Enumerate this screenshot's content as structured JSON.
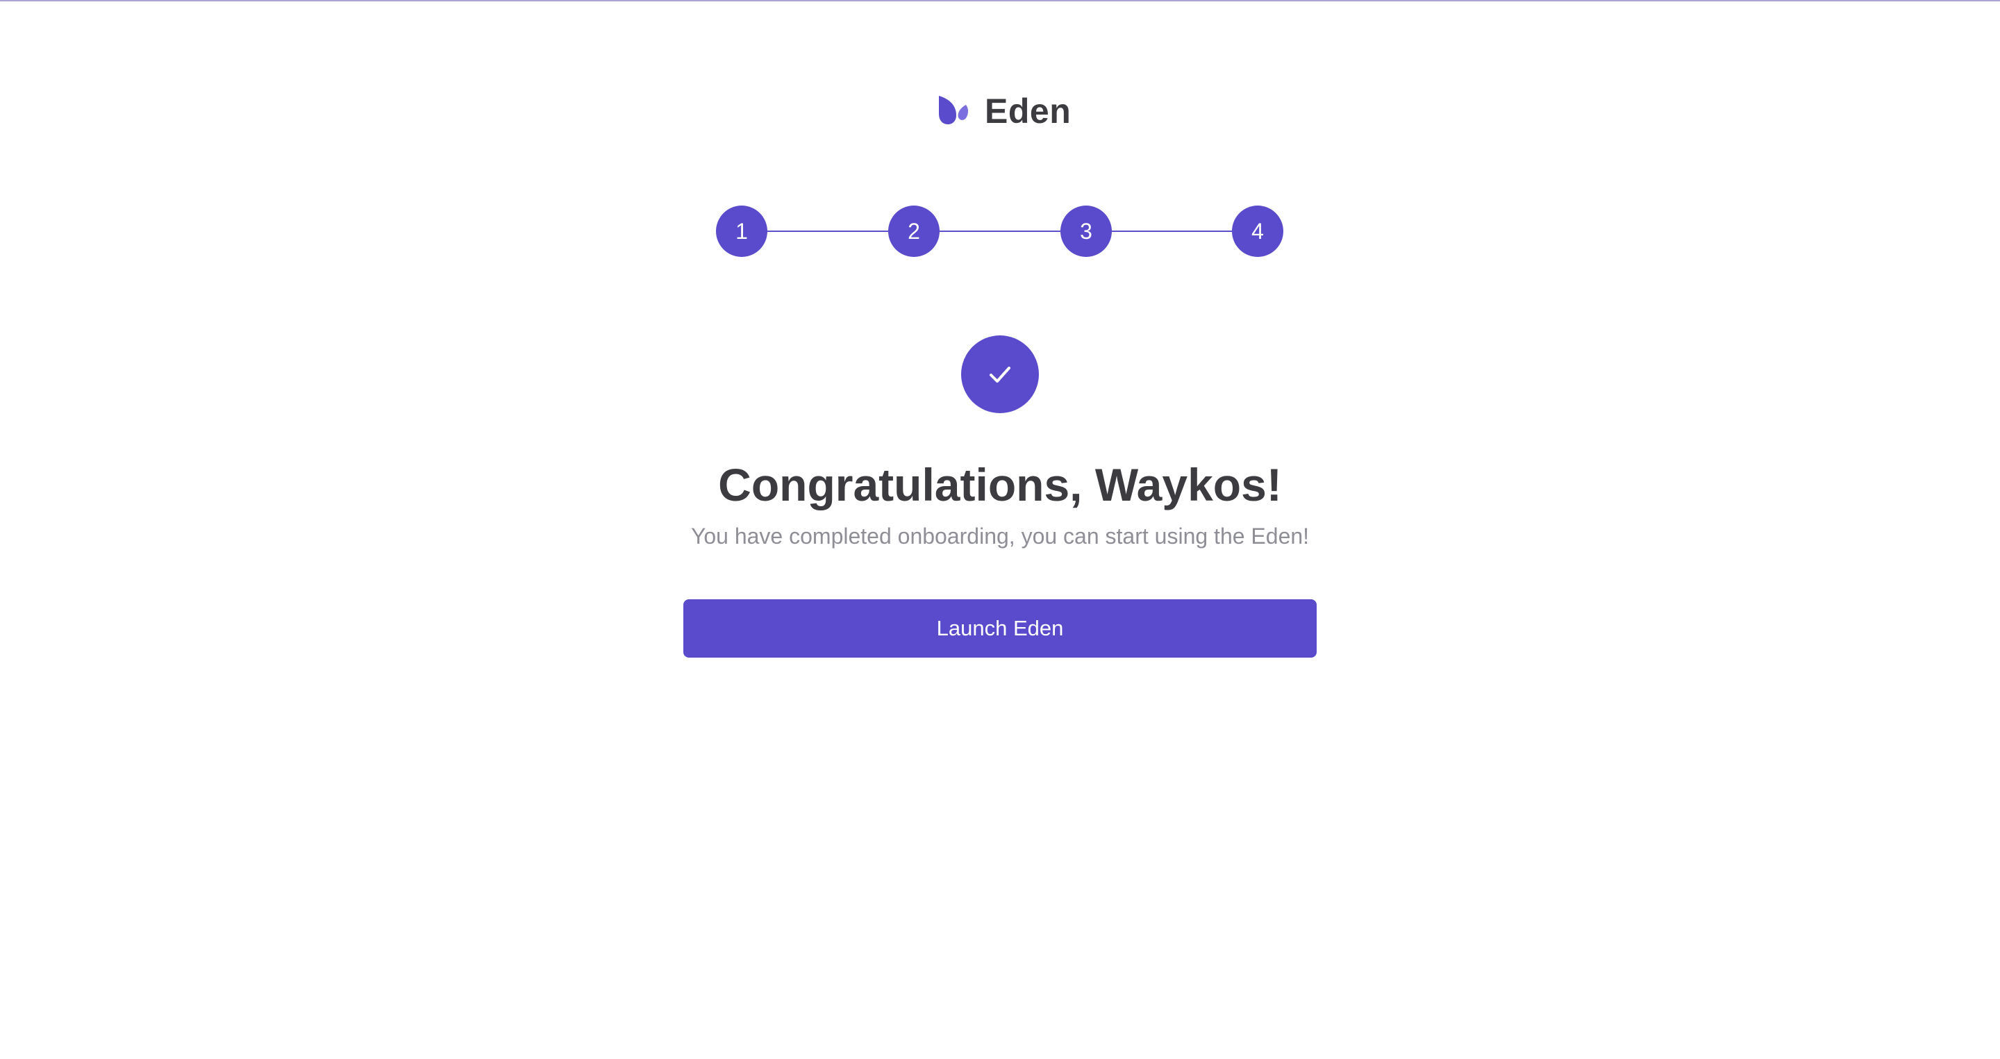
{
  "brand": {
    "name": "Eden",
    "logo_icon": "leaf-logo-icon",
    "accent_color": "#594bcb"
  },
  "stepper": {
    "steps": [
      {
        "label": "1",
        "status": "complete"
      },
      {
        "label": "2",
        "status": "complete"
      },
      {
        "label": "3",
        "status": "complete"
      },
      {
        "label": "4",
        "status": "complete"
      }
    ]
  },
  "completion": {
    "icon": "checkmark-icon",
    "title": "Congratulations, Waykos!",
    "subtitle": "You have completed onboarding, you can start using the Eden!"
  },
  "actions": {
    "launch_label": "Launch Eden"
  }
}
